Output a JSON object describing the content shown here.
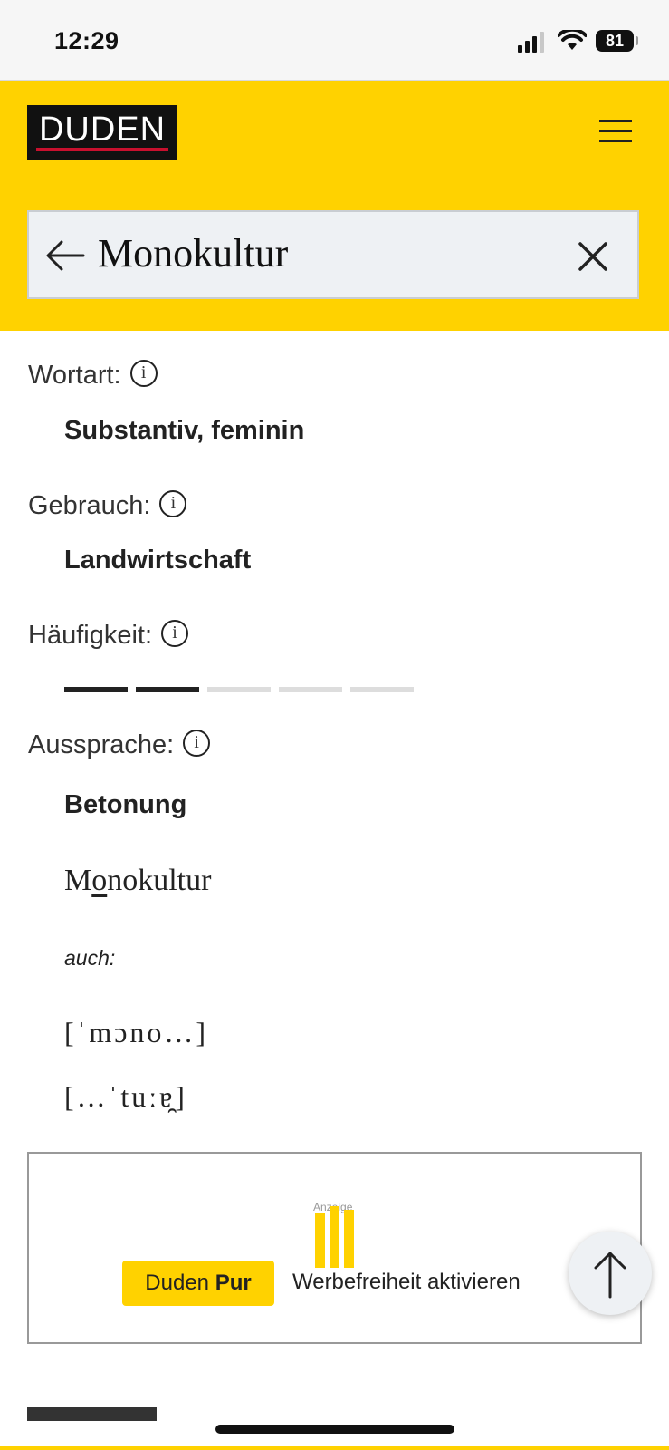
{
  "status": {
    "time": "12:29",
    "battery": "81",
    "signal_bars": 3
  },
  "header": {
    "logo_text": "DUDEN",
    "search_query": "Monokultur",
    "icons": {
      "back": "arrow-left-icon",
      "clear": "close-icon",
      "menu": "hamburger-menu-icon"
    }
  },
  "entry": {
    "wortart": {
      "label": "Wortart:",
      "value": "Substantiv, feminin"
    },
    "gebrauch": {
      "label": "Gebrauch:",
      "value": "Landwirtschaft"
    },
    "haeufigkeit": {
      "label": "Häufigkeit:",
      "level": 2,
      "max": 5
    },
    "aussprache": {
      "label": "Aussprache:",
      "betonung_label": "Betonung",
      "stress_word": "Monokultur",
      "stress_letter_index": 1,
      "auch_label": "auch:",
      "ipa": [
        "[ˈmɔno…]",
        "[…ˈtuːɐ̯]"
      ]
    }
  },
  "ad": {
    "anzeige_label": "Anzeige",
    "pur_prefix": "Duden ",
    "pur_bold": "Pur",
    "cta": "Werbefreiheit aktivieren"
  },
  "colors": {
    "brand_yellow": "#ffd200",
    "logo_red": "#c8102e",
    "freq_active": "#222222",
    "freq_inactive": "#dddddd"
  }
}
